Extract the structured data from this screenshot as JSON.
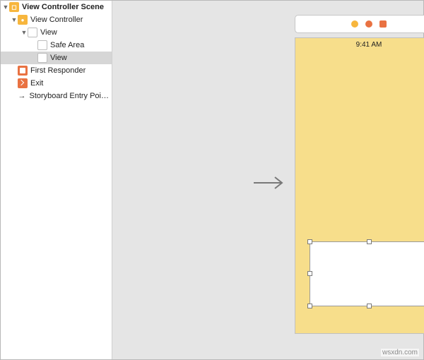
{
  "outline": {
    "scene": "View Controller Scene",
    "items": [
      {
        "label": "View Controller",
        "icon": "vc"
      },
      {
        "label": "View",
        "icon": "view"
      },
      {
        "label": "Safe Area",
        "icon": "view"
      },
      {
        "label": "View",
        "icon": "view",
        "selected": true
      },
      {
        "label": "First Responder",
        "icon": "first"
      },
      {
        "label": "Exit",
        "icon": "exit"
      },
      {
        "label": "Storyboard Entry Poi…",
        "icon": "arrow"
      }
    ]
  },
  "statusbar": {
    "time": "9:41 AM"
  },
  "dock": {
    "buttons": [
      "view-controller",
      "first-responder",
      "exit"
    ]
  },
  "watermark": "wsxdn.com"
}
